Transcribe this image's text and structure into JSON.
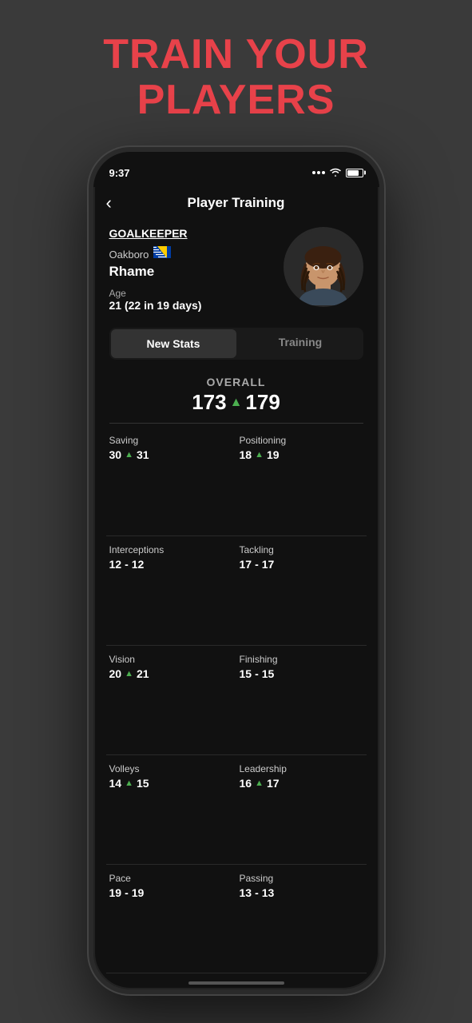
{
  "headline": {
    "line1": "TRAIN YOUR",
    "line2": "PLAYERS"
  },
  "status_bar": {
    "time": "9:37",
    "battery_pct": 80
  },
  "nav": {
    "back_label": "‹",
    "title": "Player Training"
  },
  "player": {
    "position": "GOALKEEPER",
    "club": "Oakboro",
    "name": "Rhame",
    "age_label": "Age",
    "age_value": "21 (22 in 19 days)"
  },
  "tabs": [
    {
      "label": "New Stats",
      "active": true
    },
    {
      "label": "Training",
      "active": false
    }
  ],
  "overall": {
    "label": "OVERALL",
    "old_value": "173",
    "new_value": "179"
  },
  "stats": [
    {
      "name": "Saving",
      "old": "30",
      "trend": "up",
      "new": "31",
      "col": 0
    },
    {
      "name": "Positioning",
      "old": "18",
      "trend": "up",
      "new": "19",
      "col": 1
    },
    {
      "name": "Interceptions",
      "old": "12",
      "trend": "none",
      "new": "12",
      "col": 0
    },
    {
      "name": "Tackling",
      "old": "17",
      "trend": "none",
      "new": "17",
      "col": 1
    },
    {
      "name": "Vision",
      "old": "20",
      "trend": "up",
      "new": "21",
      "col": 0
    },
    {
      "name": "Finishing",
      "old": "15",
      "trend": "none",
      "new": "15",
      "col": 1
    },
    {
      "name": "Volleys",
      "old": "14",
      "trend": "up",
      "new": "15",
      "col": 0
    },
    {
      "name": "Leadership",
      "old": "16",
      "trend": "up",
      "new": "17",
      "col": 1
    },
    {
      "name": "Pace",
      "old": "19",
      "trend": "none",
      "new": "19",
      "col": 0
    },
    {
      "name": "Passing",
      "old": "13",
      "trend": "none",
      "new": "13",
      "col": 1
    }
  ],
  "colors": {
    "accent_red": "#e8424a",
    "bg_dark": "#111111",
    "text_white": "#ffffff",
    "green_up": "#4caf50"
  }
}
